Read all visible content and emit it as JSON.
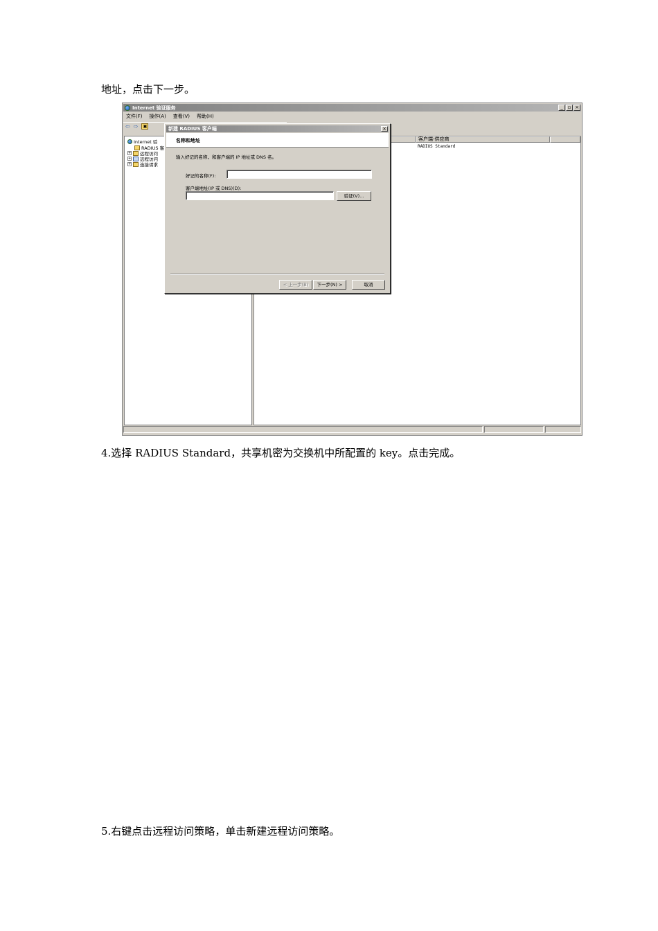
{
  "doc": {
    "intro_line": "地址，点击下一步。",
    "step4": "4.选择 RADIUS Standard，共享机密为交换机中所配置的 key。点击完成。",
    "step5": "5.右键点击远程访问策略，单击新建远程访问策略。"
  },
  "window": {
    "title": "Internet 验证服务",
    "buttons": {
      "min": "_",
      "max": "▫",
      "close": "×"
    },
    "menu": [
      "文件(F)",
      "操作(A)",
      "查看(V)",
      "帮助(H)"
    ],
    "toolbar": {
      "back": "⇦",
      "forward": "⇨",
      "folder": "▣"
    }
  },
  "tree": {
    "items": [
      {
        "label": "Internet 验",
        "expander": ""
      },
      {
        "label": "RADIUS 客",
        "expander": ""
      },
      {
        "label": "远程访问",
        "expander": "+"
      },
      {
        "label": "远程访问",
        "expander": "+"
      },
      {
        "label": "连接请求",
        "expander": "+"
      }
    ]
  },
  "list": {
    "column_header": "客户端-供应商",
    "row_value": "RADIUS Standard"
  },
  "dialog": {
    "title": "新建 RADIUS 客户端",
    "close": "×",
    "heading": "名称和地址",
    "instruction": "输入好记的名称，和客户端的 IP 地址或 DNS 名。",
    "name_label": "好记的名称(F):",
    "name_value": "",
    "address_label": "客户端地址(IP 或 DNS)(D):",
    "address_value": "",
    "verify_button": "验证(V)...",
    "back_button": "< 上一步(B)",
    "next_button": "下一步(N) >",
    "cancel_button": "取消"
  }
}
